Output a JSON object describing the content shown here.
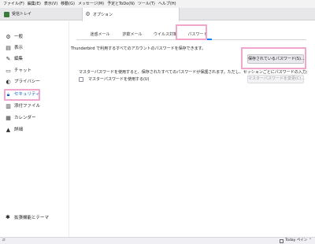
{
  "menubar": {
    "items": [
      "ファイル(F)",
      "編集(E)",
      "表示(V)",
      "移動(G)",
      "メッセージ(M)",
      "予定とToDo(N)",
      "ツール(T)",
      "ヘルプ(H)"
    ]
  },
  "window_tabs": {
    "inbox": "受信トレイ",
    "options": "オプション"
  },
  "sidebar": {
    "items": [
      {
        "label": "一般",
        "icon": "gear-icon"
      },
      {
        "label": "表示",
        "icon": "display-icon"
      },
      {
        "label": "編集",
        "icon": "pencil-icon"
      },
      {
        "label": "チャット",
        "icon": "chat-icon"
      },
      {
        "label": "プライバシー",
        "icon": "mask-icon"
      },
      {
        "label": "セキュリティ",
        "icon": "lock-icon"
      },
      {
        "label": "添付ファイル",
        "icon": "paperclip-icon"
      },
      {
        "label": "カレンダー",
        "icon": "calendar-icon"
      },
      {
        "label": "詳細",
        "icon": "advanced-icon"
      }
    ],
    "selected": "セキュリティ",
    "extensions_label": "拡張機能とテーマ"
  },
  "pref_tabs": {
    "items": [
      "迷惑メール",
      "詐欺メール",
      "ウイルス対策",
      "パスワード"
    ],
    "active": "パスワード"
  },
  "passwords": {
    "description": "Thunderbird で利用するすべてのアカウントのパスワードを保存できます。",
    "saved_button": "保存されているパスワード(S)...",
    "master_description": "マスターパスワードを使用すると、保存されたすべてのパスワードが保護されます。ただし、セッションごとにパスワードの入力が必要です。",
    "master_checkbox_label": "マスターパスワードを使用する(U)",
    "master_checkbox_checked": false,
    "change_master_button": "マスターパスワードを変更(C)..."
  },
  "statusbar": {
    "today_pane": "Today ペイン"
  },
  "colors": {
    "highlight": "#f1a6cc",
    "accent": "#0a60c8"
  }
}
